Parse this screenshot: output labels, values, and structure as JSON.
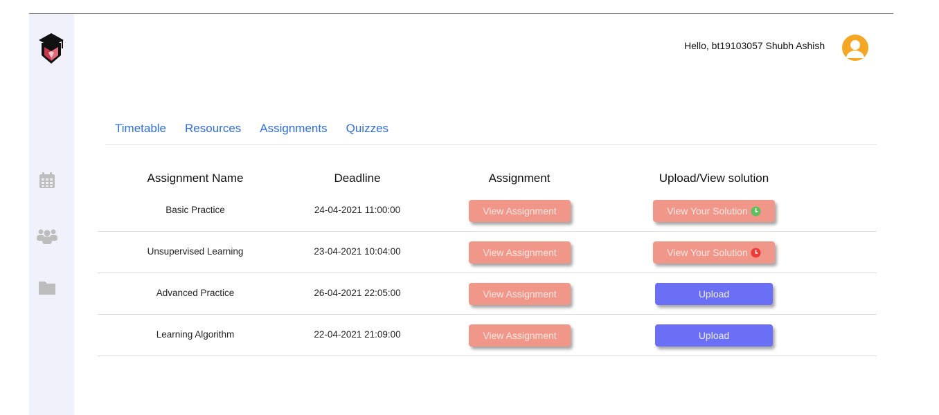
{
  "header": {
    "greeting": "Hello, bt19103057 Shubh Ashish"
  },
  "sidebar": {
    "icons": [
      "graduation-cap-logo",
      "calendar-icon",
      "users-icon",
      "folder-icon"
    ]
  },
  "tabs": [
    "Timetable",
    "Resources",
    "Assignments",
    "Quizzes"
  ],
  "table": {
    "headers": [
      "Assignment Name",
      "Deadline",
      "Assignment",
      "Upload/View solution"
    ],
    "rows": [
      {
        "name": "Basic Practice",
        "deadline": "24-04-2021 11:00:00",
        "assignment_btn": "View Assignment",
        "solution_btn": "View Your Solution",
        "solution_type": "view",
        "status": "on-time"
      },
      {
        "name": "Unsupervised Learning",
        "deadline": "23-04-2021 10:04:00",
        "assignment_btn": "View Assignment",
        "solution_btn": "View Your Solution",
        "solution_type": "view",
        "status": "late"
      },
      {
        "name": "Advanced Practice",
        "deadline": "26-04-2021 22:05:00",
        "assignment_btn": "View Assignment",
        "solution_btn": "Upload",
        "solution_type": "upload"
      },
      {
        "name": "Learning Algorithm",
        "deadline": "22-04-2021 21:09:00",
        "assignment_btn": "View Assignment",
        "solution_btn": "Upload",
        "solution_type": "upload"
      }
    ]
  },
  "colors": {
    "tab_link": "#2d6ee3",
    "salmon_button": "#f0978a",
    "upload_button": "#6b6ff5",
    "status_on_time": "#5cc05c",
    "status_late": "#f03a3a",
    "avatar": "#f5a623",
    "sidebar_bg": "#f1f1fc"
  }
}
